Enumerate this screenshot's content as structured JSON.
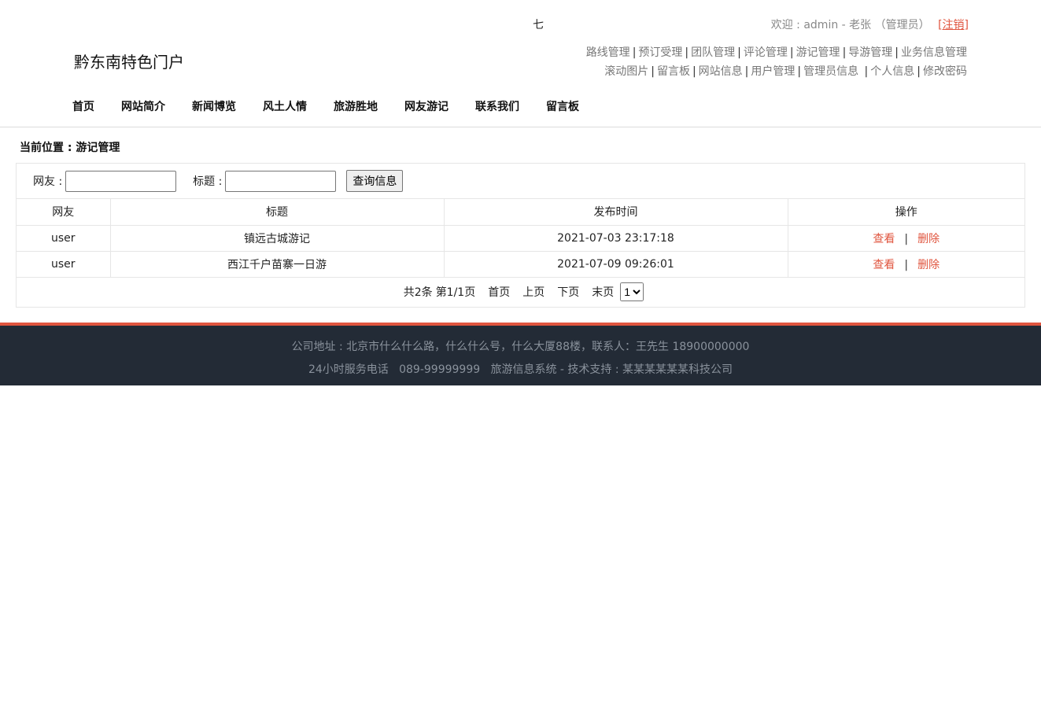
{
  "header": {
    "stray_char": "七",
    "welcome": "欢迎 : admin - 老张 （管理员）",
    "logout": "[注销]",
    "logo": "黔东南特色门户",
    "admin_row1": [
      "路线管理",
      "预订受理",
      "团队管理",
      "评论管理",
      "游记管理",
      "导游管理",
      "业务信息管理"
    ],
    "admin_row2": [
      "滚动图片",
      "留言板",
      "网站信息",
      "用户管理",
      "管理员信息",
      "个人信息",
      "修改密码"
    ],
    "nav": [
      "首页",
      "网站简介",
      "新闻博览",
      "风土人情",
      "旅游胜地",
      "网友游记",
      "联系我们",
      "留言板"
    ]
  },
  "breadcrumb": "当前位置 : 游记管理",
  "search": {
    "user_label": "网友 :",
    "user_value": "",
    "title_label": "标题 :",
    "title_value": "",
    "button": "查询信息"
  },
  "table": {
    "columns": [
      "网友",
      "标题",
      "发布时间",
      "操作"
    ],
    "rows": [
      {
        "user": "user",
        "title": "镇远古城游记",
        "time": "2021-07-03 23:17:18",
        "view": "查看",
        "delete": "删除"
      },
      {
        "user": "user",
        "title": "西江千户苗寨一日游",
        "time": "2021-07-09 09:26:01",
        "view": "查看",
        "delete": "删除"
      }
    ],
    "op_separator": "|"
  },
  "pager": {
    "total": "共2条",
    "page": "第1/1页",
    "first": "首页",
    "prev": "上页",
    "next": "下页",
    "last": "末页",
    "select_value": "1"
  },
  "footer": {
    "line1": "公司地址 : 北京市什么什么路，什么什么号，什么大厦88楼，联系人：王先生 18900000000",
    "line2": "24小时服务电话   089-99999999   旅游信息系统 - 技术支持 : 某某某某某某科技公司"
  },
  "colors": {
    "accent": "#e0553f",
    "footer_bg": "#232b36"
  }
}
